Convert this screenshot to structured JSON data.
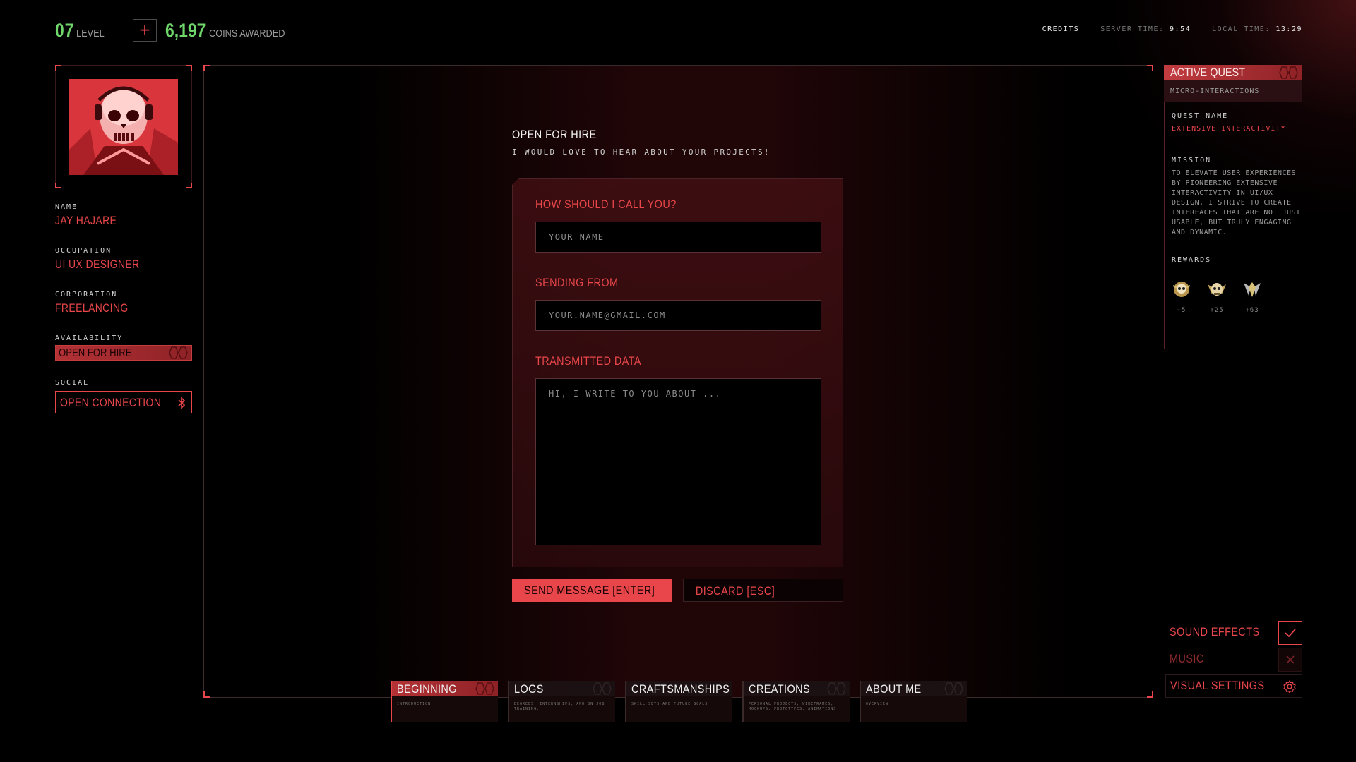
{
  "header": {
    "level_value": "07",
    "level_label": "LEVEL",
    "plus_label": "+",
    "coins_value": "6,197",
    "coins_label": "COINS AWARDED",
    "credits": "CREDITS",
    "server_time_label": "SERVER TIME:",
    "server_time": "9:54",
    "local_time_label": "LOCAL TIME:",
    "local_time": "13:29"
  },
  "profile": {
    "name_label": "NAME",
    "name": "JAY HAJARE",
    "occupation_label": "OCCUPATION",
    "occupation": "UI UX DESIGNER",
    "corporation_label": "CORPORATION",
    "corporation": "FREELANCING",
    "availability_label": "AVAILABILITY",
    "availability": "OPEN FOR HIRE",
    "social_label": "SOCIAL",
    "social_button": "OPEN CONNECTION"
  },
  "form": {
    "title": "OPEN FOR HIRE",
    "subtitle": "I WOULD LOVE TO HEAR ABOUT YOUR PROJECTS!",
    "name_label": "HOW SHOULD I CALL YOU?",
    "name_placeholder": "YOUR NAME",
    "email_label": "SENDING FROM",
    "email_placeholder": "YOUR.NAME@GMAIL.COM",
    "message_label": "TRANSMITTED DATA",
    "message_placeholder": "HI, I WRITE TO YOU ABOUT ...",
    "send_button": "SEND MESSAGE [ENTER]",
    "discard_button": "DISCARD [ESC]"
  },
  "tabs": [
    {
      "title": "BEGINNING",
      "desc": "INTRODUCTION",
      "active": true
    },
    {
      "title": "LOGS",
      "desc": "DEGREES, INTERNSHIPS, AND ON JOB TRAINING.",
      "active": false
    },
    {
      "title": "CRAFTSMANSHIPS",
      "desc": "SKILL SETS AND FUTURE GOALS",
      "active": false
    },
    {
      "title": "CREATIONS",
      "desc": "PERSONAL PROJECTS, WIREFRAMES, MOCKUPS, PROTOTYPES, ANIMATIONS",
      "active": false
    },
    {
      "title": "ABOUT ME",
      "desc": "OVERVIEW",
      "active": false
    }
  ],
  "quest": {
    "header": "ACTIVE QUEST",
    "subheader": "MICRO-INTERACTIONS",
    "quest_name_label": "QUEST NAME",
    "quest_name": "EXTENSIVE INTERACTIVITY",
    "mission_label": "MISSION",
    "mission": "TO ELEVATE USER EXPERIENCES BY PIONEERING EXTENSIVE INTERACTIVITY IN UI/UX DESIGN. I STRIVE TO CREATE INTERFACES THAT ARE NOT JUST USABLE, BUT TRULY ENGAGING AND DYNAMIC.",
    "rewards_label": "REWARDS",
    "rewards": [
      {
        "value": "+5",
        "icon": "skull-badge-icon"
      },
      {
        "value": "+25",
        "icon": "skull-wings-badge-icon"
      },
      {
        "value": "+63",
        "icon": "winged-crest-badge-icon"
      }
    ]
  },
  "settings": {
    "sound_effects": "SOUND EFFECTS",
    "sound_effects_on": true,
    "music": "MUSIC",
    "music_on": false,
    "visual_settings": "VISUAL SETTINGS"
  },
  "colors": {
    "accent": "#e8464a",
    "green": "#6fd66a",
    "background": "#000000"
  }
}
